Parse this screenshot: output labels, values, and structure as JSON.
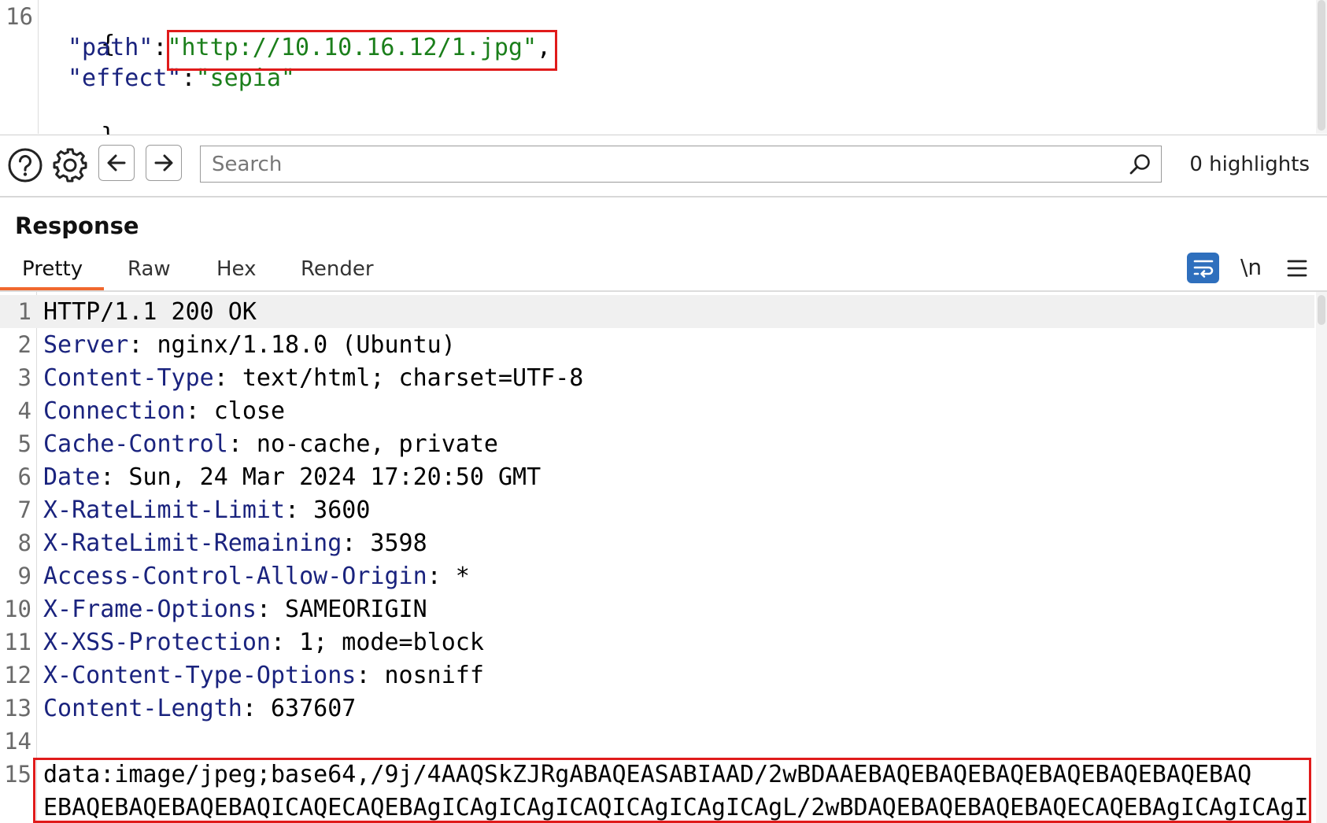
{
  "request": {
    "lines": [
      {
        "num": "16",
        "open": "{"
      },
      {
        "key": "\"path\"",
        "sep": ":",
        "value": "\"http://10.10.16.12/1.jpg\"",
        "tail": ","
      },
      {
        "key": "\"effect\"",
        "sep": ":",
        "value": "\"sepia\""
      },
      {
        "close": "}"
      }
    ]
  },
  "toolbar": {
    "help_icon": "help-circle-icon",
    "settings_icon": "gear-icon",
    "back_icon": "arrow-left-icon",
    "forward_icon": "arrow-right-icon",
    "search_placeholder": "Search",
    "search_icon": "magnifier-icon",
    "highlights": "0 highlights"
  },
  "response": {
    "title": "Response",
    "tabs": [
      {
        "label": "Pretty",
        "active": true
      },
      {
        "label": "Raw"
      },
      {
        "label": "Hex"
      },
      {
        "label": "Render"
      }
    ],
    "wrap_icon": "word-wrap-icon",
    "newline_label": "\\n",
    "menu_icon": "hamburger-menu-icon",
    "lines": [
      {
        "num": "1",
        "text": "HTTP/1.1 200 OK"
      },
      {
        "num": "2",
        "key": "Server",
        "value": ": nginx/1.18.0 (Ubuntu)"
      },
      {
        "num": "3",
        "key": "Content-Type",
        "value": ": text/html; charset=UTF-8"
      },
      {
        "num": "4",
        "key": "Connection",
        "value": ": close"
      },
      {
        "num": "5",
        "key": "Cache-Control",
        "value": ": no-cache, private"
      },
      {
        "num": "6",
        "key": "Date",
        "value": ": Sun, 24 Mar 2024 17:20:50 GMT"
      },
      {
        "num": "7",
        "key": "X-RateLimit-Limit",
        "value": ": 3600"
      },
      {
        "num": "8",
        "key": "X-RateLimit-Remaining",
        "value": ": 3598"
      },
      {
        "num": "9",
        "key": "Access-Control-Allow-Origin",
        "value": ": *"
      },
      {
        "num": "10",
        "key": "X-Frame-Options",
        "value": ": SAMEORIGIN"
      },
      {
        "num": "11",
        "key": "X-XSS-Protection",
        "value": ": 1; mode=block"
      },
      {
        "num": "12",
        "key": "X-Content-Type-Options",
        "value": ": nosniff"
      },
      {
        "num": "13",
        "key": "Content-Length",
        "value": ": 637607"
      },
      {
        "num": "14",
        "text": ""
      },
      {
        "num": "15",
        "text": "data:image/jpeg;base64,/9j/4AAQSkZJRgABAQEASABIAAD/2wBDAAEBAQEBAQEBAQEBAQEBAQEBAQEBAQ"
      },
      {
        "num": "",
        "text": "EBAQEBAQEBAQEBAQICAQECAQEBAgICAgICAgICAQICAgICAgICAgL/2wBDAQEBAQEBAQEBAQECAQEBAgICAgICAgI"
      }
    ]
  },
  "colors": {
    "header_key": "#1a237e",
    "json_string": "#1b7f1b",
    "highlight_box": "#e01b1b",
    "active_tab": "#f0682e",
    "wrap_button": "#2e6fbd"
  }
}
